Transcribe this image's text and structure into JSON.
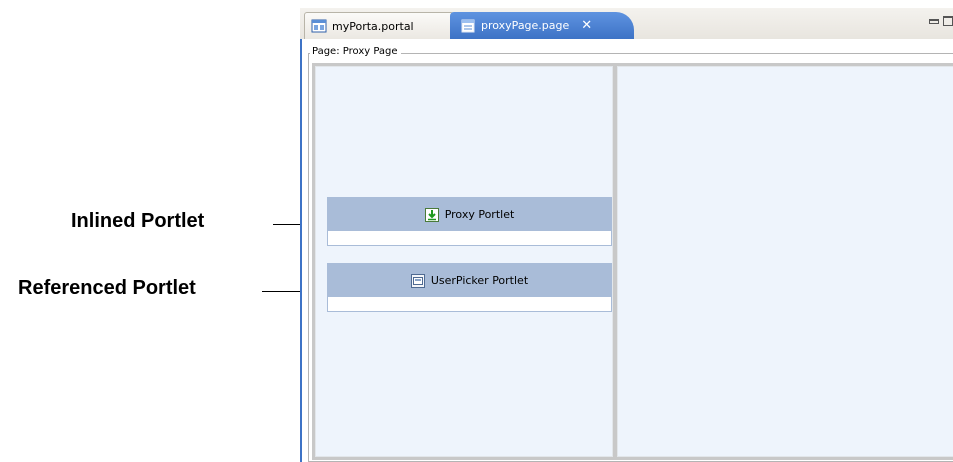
{
  "callouts": {
    "inlined_label": "Inlined Portlet",
    "referenced_label": "Referenced Portlet"
  },
  "tabs": [
    {
      "label": "myPorta.portal",
      "icon": "portal-icon",
      "active": false
    },
    {
      "label": "proxyPage.page",
      "icon": "page-icon",
      "active": true,
      "close": "✕"
    }
  ],
  "page": {
    "legend": "Page: Proxy Page"
  },
  "portlets": [
    {
      "title": "Proxy Portlet",
      "icon": "proxy-portlet-icon"
    },
    {
      "title": "UserPicker Portlet",
      "icon": "userpicker-portlet-icon"
    }
  ],
  "colors": {
    "active_tab": "#3d73c6",
    "portlet_header": "#a9bcd8",
    "column_bg": "#eef4fc"
  }
}
